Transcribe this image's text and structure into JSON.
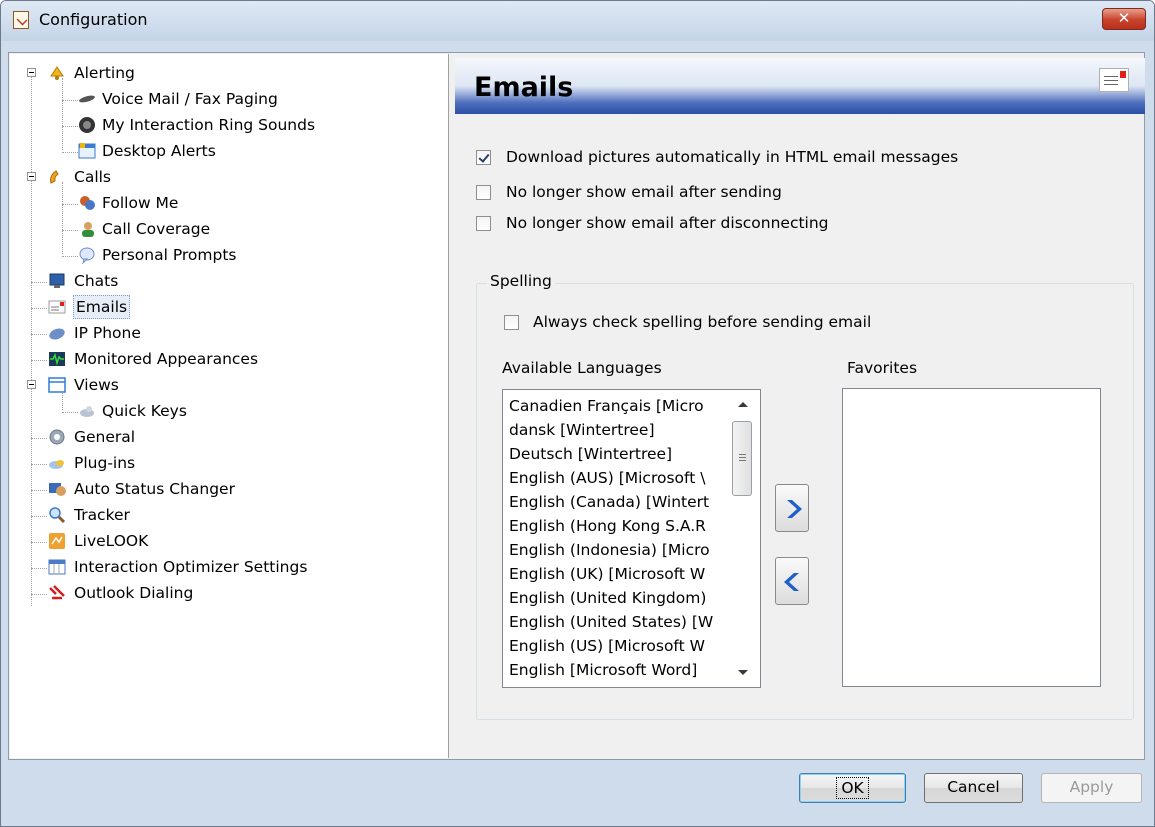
{
  "window": {
    "title": "Configuration",
    "close_label": "✕"
  },
  "tree": {
    "items": [
      {
        "label": "Alerting"
      },
      {
        "label": "Voice Mail / Fax Paging"
      },
      {
        "label": "My Interaction Ring Sounds"
      },
      {
        "label": "Desktop Alerts"
      },
      {
        "label": "Calls"
      },
      {
        "label": "Follow Me"
      },
      {
        "label": "Call Coverage"
      },
      {
        "label": "Personal Prompts"
      },
      {
        "label": "Chats"
      },
      {
        "label": "Emails"
      },
      {
        "label": "IP Phone"
      },
      {
        "label": "Monitored Appearances"
      },
      {
        "label": "Views"
      },
      {
        "label": "Quick Keys"
      },
      {
        "label": "General"
      },
      {
        "label": "Plug-ins"
      },
      {
        "label": "Auto Status Changer"
      },
      {
        "label": "Tracker"
      },
      {
        "label": "LiveLOOK"
      },
      {
        "label": "Interaction Optimizer Settings"
      },
      {
        "label": "Outlook Dialing"
      }
    ]
  },
  "panel": {
    "title": "Emails",
    "options": [
      {
        "label": "Download pictures automatically in HTML email messages",
        "checked": true
      },
      {
        "label": "No longer show email after sending",
        "checked": false
      },
      {
        "label": "No longer show email after disconnecting",
        "checked": false
      }
    ],
    "spelling": {
      "legend": "Spelling",
      "always_check": {
        "label": "Always check spelling before sending email",
        "checked": false
      },
      "available_label": "Available Languages",
      "favorites_label": "Favorites",
      "languages": [
        "Canadien Français [Micro",
        "dansk [Wintertree]",
        "Deutsch [Wintertree]",
        "English (AUS) [Microsoft \\",
        "English (Canada) [Wintert",
        "English (Hong Kong S.A.R",
        "English (Indonesia) [Micro",
        "English (UK) [Microsoft W",
        "English (United Kingdom)",
        "English (United States) [W",
        "English (US) [Microsoft W",
        "English [Microsoft Word]"
      ],
      "favorites": []
    }
  },
  "buttons": {
    "ok": "OK",
    "cancel": "Cancel",
    "apply": "Apply"
  },
  "colors": {
    "banner_blue": "#2b4ea8",
    "arrow_blue": "#1f5fc8",
    "close_red": "#c9422b"
  }
}
